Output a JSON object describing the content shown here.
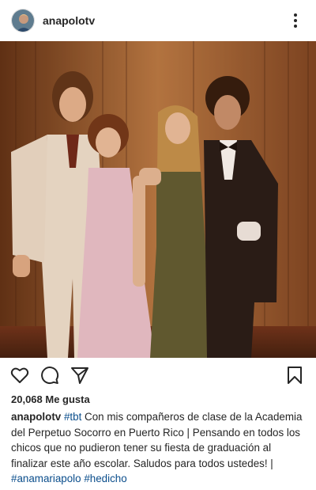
{
  "post": {
    "username": "anapolotv",
    "likes_text": "20,068 Me gusta",
    "caption": {
      "username": "anapolotv",
      "tag_tbt": "#tbt",
      "text": " Con mis compañeros de clase de la Academia del Perpetuo Socorro en Puerto Rico | Pensando en todos los chicos que no pudieron tener su fiesta de graduación al finalizar este año escolar. Saludos para todos ustedes! | ",
      "tag_anamariapolo": "#anamariapolo",
      "tag_hedicho": "#hedicho"
    }
  },
  "icons": {
    "more": "more-vertical-icon",
    "like": "heart-icon",
    "comment": "comment-icon",
    "share": "send-icon",
    "save": "bookmark-icon"
  },
  "colors": {
    "text": "#262626",
    "hashtag": "#0b4e8c",
    "photo_tone": "#6b3a1f"
  }
}
